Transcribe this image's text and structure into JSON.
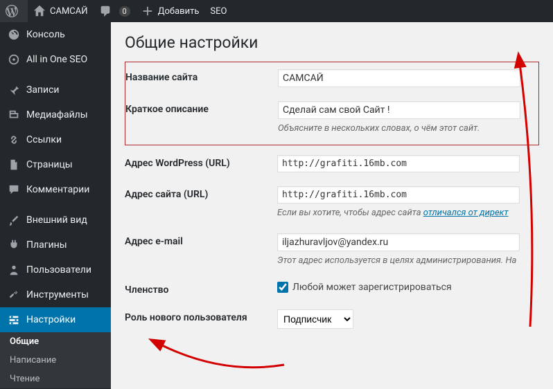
{
  "adminbar": {
    "site_name": "САМСАЙ",
    "comments_count": "0",
    "add_new": "Добавить",
    "seo": "SEO"
  },
  "sidebar": {
    "items": [
      {
        "label": "Консоль"
      },
      {
        "label": "All in One SEO"
      },
      {
        "label": "Записи"
      },
      {
        "label": "Медиафайлы"
      },
      {
        "label": "Ссылки"
      },
      {
        "label": "Страницы"
      },
      {
        "label": "Комментарии"
      },
      {
        "label": "Внешний вид"
      },
      {
        "label": "Плагины"
      },
      {
        "label": "Пользователи"
      },
      {
        "label": "Инструменты"
      },
      {
        "label": "Настройки"
      }
    ],
    "submenu": [
      {
        "label": "Общие"
      },
      {
        "label": "Написание"
      },
      {
        "label": "Чтение"
      }
    ]
  },
  "page": {
    "title": "Общие настройки"
  },
  "fields": {
    "site_title_label": "Название сайта",
    "site_title_value": "САМСАЙ",
    "tagline_label": "Краткое описание",
    "tagline_value": "Сделай сам свой Сайт !",
    "tagline_desc": "Объясните в нескольких словах, о чём этот сайт.",
    "wpurl_label": "Адрес WordPress (URL)",
    "wpurl_value": "http://grafiti.16mb.com",
    "siteurl_label": "Адрес сайта (URL)",
    "siteurl_value": "http://grafiti.16mb.com",
    "siteurl_desc_pre": "Если вы хотите, чтобы адрес сайта ",
    "siteurl_desc_link": "отличался от директ",
    "email_label": "Адрес e-mail",
    "email_value": "iljazhuravljov@yandex.ru",
    "email_desc": "Этот адрес используется в целях администрирования. На",
    "membership_label": "Членство",
    "membership_cb": "Любой может зарегистрироваться",
    "role_label": "Роль нового пользователя",
    "role_value": "Подписчик"
  }
}
